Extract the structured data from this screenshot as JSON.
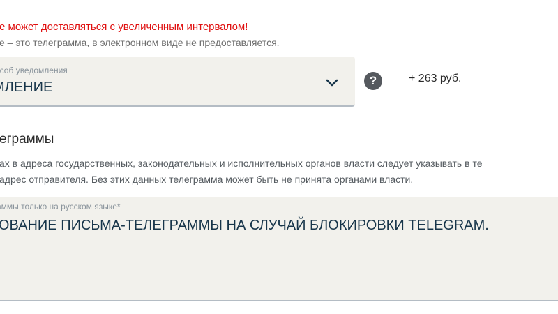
{
  "warning_text": "е может доставляться с увеличенным интервалом!",
  "note_text": "е – это телеграмма, в электронном виде не предоставляется.",
  "notification_select": {
    "label": "особ уведомления",
    "value": "МЛЕНИЕ",
    "chevron_icon": "chevron-down-icon"
  },
  "help_icon": {
    "glyph": "?",
    "icon": "question-icon"
  },
  "price": "+ 263 руб.",
  "section_title": "еграммы",
  "hint_line1": "ах в адреса государственных, законодательных и исполнительных органов власти следует указывать в те",
  "hint_line2": "адрес отправителя. Без этих данных телеграмма может быть не принята органами власти.",
  "message_field": {
    "label": "аммы только на русском языке*",
    "value": "РОВАНИЕ ПИСЬМА-ТЕЛЕГРАММЫ НА СЛУЧАЙ БЛОКИРОВКИ TELEGRAM."
  },
  "colors": {
    "warning": "#e01010",
    "field_bg": "#f2f1ec",
    "value_text": "#17354a",
    "help_icon_bg": "#55595e"
  }
}
